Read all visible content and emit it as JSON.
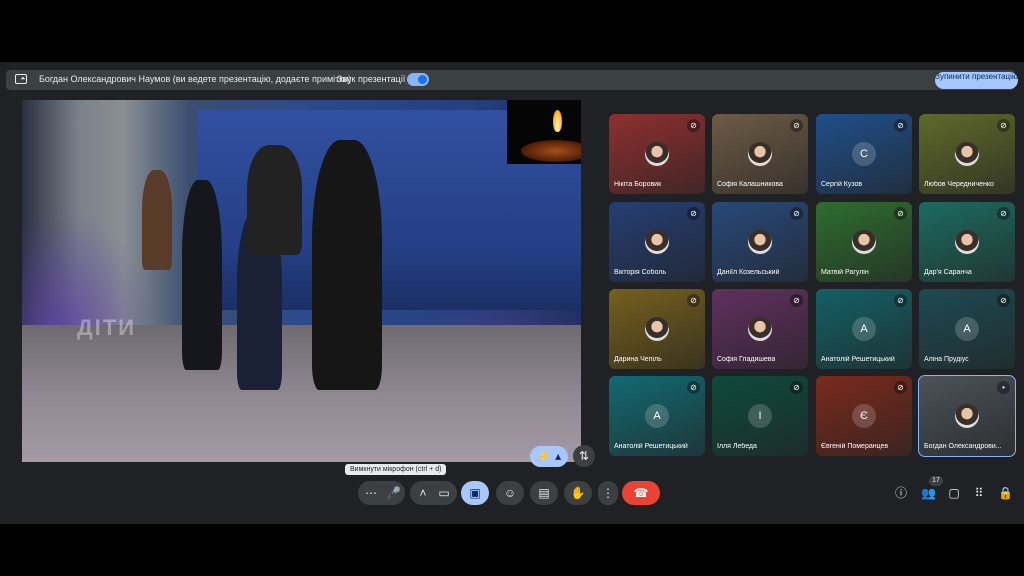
{
  "presenter_bar": {
    "text": "Богдан Олександрович Наумов (ви ведете презентацію, додаєте примітки)",
    "audio_label": "Звук презентації",
    "audio_on": true,
    "stop_button": "Зупинити презентацію"
  },
  "presentation": {
    "overlay_text": "ДІТИ"
  },
  "participants": [
    {
      "name": "Нікіта Боровик",
      "avatar": "",
      "color": "#8f2f2f",
      "mic": "muted"
    },
    {
      "name": "Софія Калашникова",
      "avatar": "",
      "color": "#6d5b46",
      "mic": "muted"
    },
    {
      "name": "Сергій Кузов",
      "avatar": "С",
      "color": "#1f4f8a",
      "mic": "muted"
    },
    {
      "name": "Любов Чередниченко",
      "avatar": "",
      "color": "#5f6a2a",
      "mic": "muted"
    },
    {
      "name": "Вікторія Соболь",
      "avatar": "",
      "color": "#243e74",
      "mic": "muted"
    },
    {
      "name": "Даніїл Козельський",
      "avatar": "",
      "color": "#28497a",
      "mic": "muted"
    },
    {
      "name": "Матвій Рагулін",
      "avatar": "",
      "color": "#2e6d2f",
      "mic": "muted"
    },
    {
      "name": "Дар'я Саранча",
      "avatar": "",
      "color": "#1c6b5f",
      "mic": "muted"
    },
    {
      "name": "Дарина Чепіль",
      "avatar": "",
      "color": "#76601c",
      "mic": "muted"
    },
    {
      "name": "Софія Гладишева",
      "avatar": "",
      "color": "#60305f",
      "mic": "muted"
    },
    {
      "name": "Анатолій Решетицький",
      "avatar": "А",
      "color": "#136066",
      "mic": "muted"
    },
    {
      "name": "Аліна Прудіус",
      "avatar": "А",
      "color": "#1d4a52",
      "mic": "muted"
    },
    {
      "name": "Анатолій Решетицький",
      "avatar": "А",
      "color": "#126a72",
      "mic": "muted"
    },
    {
      "name": "Ілля Лебеда",
      "avatar": "І",
      "color": "#0e4a3c",
      "mic": "muted"
    },
    {
      "name": "Євгеній Померанцев",
      "avatar": "Є",
      "color": "#7a2a1c",
      "mic": "muted"
    },
    {
      "name": "Богдан Олександрови...",
      "avatar": "",
      "color": "#4a5259",
      "mic": "on",
      "self": true
    }
  ],
  "toolbar": {
    "tooltip": "Вимкнути мікрофон (ctrl + d)",
    "participant_count": "17",
    "icons": {
      "more": "more-horizontal-icon",
      "mic": "microphone-icon",
      "camera": "camera-icon",
      "present": "present-screen-icon",
      "emoji": "emoji-icon",
      "captions": "captions-icon",
      "hand": "raise-hand-icon",
      "more_vert": "more-vertical-icon",
      "hangup": "hang-up-icon"
    }
  }
}
